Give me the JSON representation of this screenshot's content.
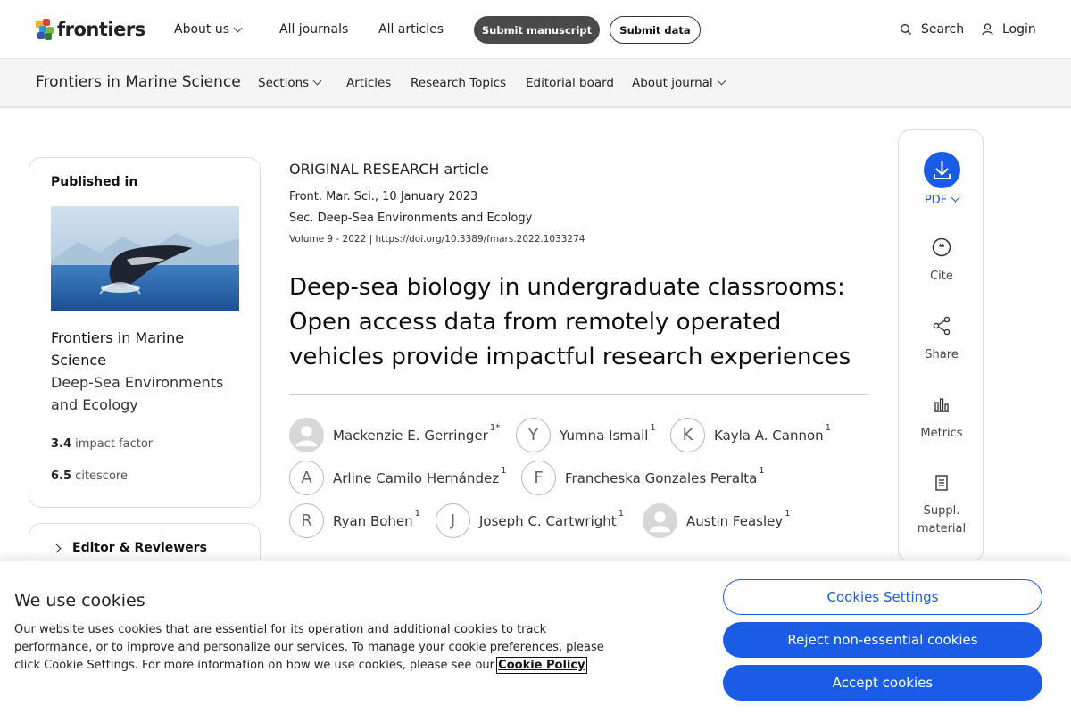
{
  "site": {
    "logo_text": "frontiers",
    "nav": [
      "About us",
      "All journals",
      "All articles"
    ],
    "submit_manuscript": "Submit manuscript",
    "submit_data": "Submit data",
    "search": "Search",
    "login": "Login"
  },
  "journal_bar": {
    "name": "Frontiers in Marine Science",
    "nav": [
      "Sections",
      "Articles",
      "Research Topics",
      "Editorial board",
      "About journal"
    ]
  },
  "sidebar": {
    "published_in": "Published in",
    "journal": "Frontiers in Marine Science",
    "section": "Deep-Sea Environments and Ecology",
    "impact_value": "3.4",
    "impact_label": "impact factor",
    "citescore_value": "6.5",
    "citescore_label": "citescore",
    "editor_reviewers": "Editor & Reviewers"
  },
  "article": {
    "type": "ORIGINAL RESEARCH article",
    "journal_date": "Front. Mar. Sci., 10 January 2023",
    "section": "Sec. Deep-Sea Environments and Ecology",
    "volume_doi": "Volume 9 - 2022 | https://doi.org/10.3389/fmars.2022.1033274",
    "title": "Deep-sea biology in undergraduate classrooms: Open access data from remotely operated vehicles provide impactful research experiences",
    "authors": [
      {
        "initial": "",
        "name": "Mackenzie E. Gerringer",
        "aff": "1*"
      },
      {
        "initial": "Y",
        "name": "Yumna Ismail",
        "aff": "1"
      },
      {
        "initial": "K",
        "name": "Kayla A. Cannon",
        "aff": "1"
      },
      {
        "initial": "A",
        "name": "Arline Camilo Hernández",
        "aff": "1"
      },
      {
        "initial": "F",
        "name": "Francheska Gonzales Peralta",
        "aff": "1"
      },
      {
        "initial": "R",
        "name": "Ryan Bohen",
        "aff": "1"
      },
      {
        "initial": "J",
        "name": "Joseph C. Cartwright",
        "aff": "1"
      },
      {
        "initial": "",
        "name": "Austin Feasley",
        "aff": "1"
      }
    ]
  },
  "actions": {
    "pdf": "PDF",
    "cite": "Cite",
    "share": "Share",
    "metrics": "Metrics",
    "suppl": "Suppl. material"
  },
  "cookie": {
    "heading": "We use cookies",
    "text": "Our website uses cookies that are essential for its operation and additional cookies to track performance, or to improve and personalize our services. To manage your cookie preferences, please click Cookie Settings. For more information on how we use cookies, please see our",
    "policy_link": "Cookie Policy",
    "settings": "Cookies Settings",
    "reject": "Reject non-essential cookies",
    "accept": "Accept cookies"
  },
  "colors": {
    "accent": "#1a5ce6",
    "dark_button": "#4a4a4a"
  }
}
